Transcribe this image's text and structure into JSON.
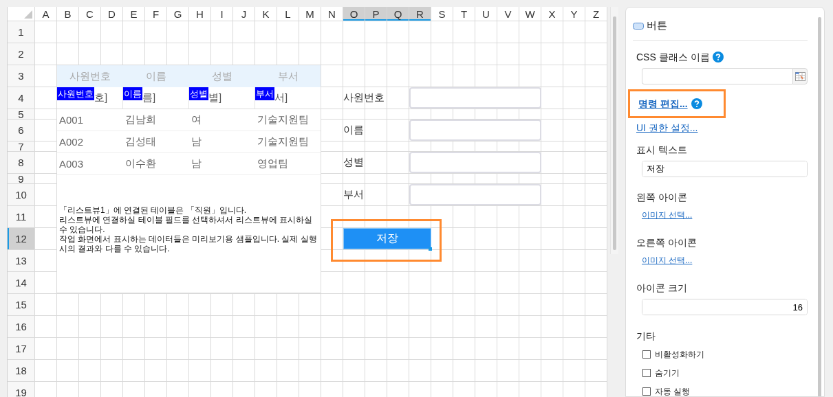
{
  "spreadsheet": {
    "columns": [
      {
        "label": "A",
        "selected": false
      },
      {
        "label": "B",
        "selected": false
      },
      {
        "label": "C",
        "selected": false
      },
      {
        "label": "D",
        "selected": false
      },
      {
        "label": "E",
        "selected": false
      },
      {
        "label": "F",
        "selected": false
      },
      {
        "label": "G",
        "selected": false
      },
      {
        "label": "H",
        "selected": false
      },
      {
        "label": "I",
        "selected": false
      },
      {
        "label": "J",
        "selected": false
      },
      {
        "label": "K",
        "selected": false
      },
      {
        "label": "L",
        "selected": false
      },
      {
        "label": "M",
        "selected": false
      },
      {
        "label": "N",
        "selected": false
      },
      {
        "label": "O",
        "selected": true
      },
      {
        "label": "P",
        "selected": true
      },
      {
        "label": "Q",
        "selected": true
      },
      {
        "label": "R",
        "selected": true
      },
      {
        "label": "S",
        "selected": false
      },
      {
        "label": "T",
        "selected": false
      },
      {
        "label": "U",
        "selected": false
      },
      {
        "label": "V",
        "selected": false
      },
      {
        "label": "W",
        "selected": false
      },
      {
        "label": "X",
        "selected": false
      },
      {
        "label": "Y",
        "selected": false
      },
      {
        "label": "Z",
        "selected": false
      }
    ],
    "rows": [
      {
        "label": "1",
        "selected": false
      },
      {
        "label": "2",
        "selected": false
      },
      {
        "label": "3",
        "selected": false
      },
      {
        "label": "4",
        "selected": false
      },
      {
        "label": "5",
        "selected": false
      },
      {
        "label": "6",
        "selected": false
      },
      {
        "label": "7",
        "selected": false
      },
      {
        "label": "8",
        "selected": false
      },
      {
        "label": "9",
        "selected": false
      },
      {
        "label": "10",
        "selected": false
      },
      {
        "label": "11",
        "selected": false
      },
      {
        "label": "12",
        "selected": true
      },
      {
        "label": "13",
        "selected": false
      },
      {
        "label": "14",
        "selected": false
      },
      {
        "label": "15",
        "selected": false
      },
      {
        "label": "16",
        "selected": false
      },
      {
        "label": "17",
        "selected": false
      },
      {
        "label": "18",
        "selected": false
      },
      {
        "label": "19",
        "selected": false
      }
    ]
  },
  "list_view": {
    "columns": [
      {
        "header": "사원번호",
        "field_tag": "사원번호",
        "field_text": "호]"
      },
      {
        "header": "이름",
        "field_tag": "이름",
        "field_text": "름]"
      },
      {
        "header": "성별",
        "field_tag": "성별",
        "field_text": "별]"
      },
      {
        "header": "부서",
        "field_tag": "부서",
        "field_text": "서]"
      }
    ],
    "rows": [
      [
        "A001",
        "김남희",
        "여",
        "기술지원팀"
      ],
      [
        "A002",
        "김성태",
        "남",
        "기술지원팀"
      ],
      [
        "A003",
        "이수환",
        "남",
        "영업팀"
      ]
    ],
    "note": "「리스트뷰1」에 연결된 테이블은 「직원」입니다.\n리스트뷰에 연결하실 테이블 필드를 선택하셔서 리스트뷰에 표시하실 수 있습니다.\n작업 화면에서 표시하는 데이터들은 미리보기용 샘플입니다. 실제 실행시의 결과와 다를 수 있습니다."
  },
  "form": {
    "fields": [
      {
        "label": "사원번호"
      },
      {
        "label": "이름"
      },
      {
        "label": "성별"
      },
      {
        "label": "부서"
      }
    ]
  },
  "button": {
    "label": "저장",
    "highlighted": true
  },
  "properties": {
    "title": "버튼",
    "css_class": {
      "label": "CSS 클래스 이름"
    },
    "links": [
      {
        "label": "명령 편집...",
        "bold": true,
        "help": true,
        "highlighted": true
      },
      {
        "label": "UI 권한 설정...",
        "bold": false,
        "help": false,
        "highlighted": false
      }
    ],
    "display_text": {
      "label": "표시 텍스트",
      "value": "저장"
    },
    "left_icon": {
      "label": "왼쪽 아이콘",
      "link": "이미지 선택..."
    },
    "right_icon": {
      "label": "오른쪽 아이콘",
      "link": "이미지 선택..."
    },
    "icon_size": {
      "label": "아이콘 크기",
      "value": "16"
    },
    "other": {
      "label": "기타",
      "options": [
        {
          "label": "비활성화하기",
          "checked": false
        },
        {
          "label": "숨기기",
          "checked": false
        },
        {
          "label": "자동 실행",
          "checked": false
        }
      ]
    }
  }
}
